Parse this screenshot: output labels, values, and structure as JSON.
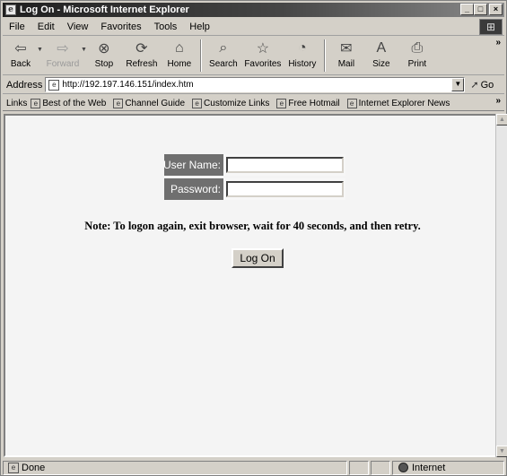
{
  "window": {
    "title": "Log On - Microsoft Internet Explorer"
  },
  "menu": [
    "File",
    "Edit",
    "View",
    "Favorites",
    "Tools",
    "Help"
  ],
  "toolbar": {
    "back": "Back",
    "forward": "Forward",
    "stop": "Stop",
    "refresh": "Refresh",
    "home": "Home",
    "search": "Search",
    "favorites": "Favorites",
    "history": "History",
    "mail": "Mail",
    "size": "Size",
    "print": "Print"
  },
  "address": {
    "label": "Address",
    "url": "http://192.197.146.151/index.htm",
    "go": "Go"
  },
  "links": {
    "label": "Links",
    "items": [
      "Best of the Web",
      "Channel Guide",
      "Customize Links",
      "Free Hotmail",
      "Internet Explorer News"
    ]
  },
  "form": {
    "username_label": "User Name:",
    "password_label": "Password:",
    "username_value": "",
    "password_value": "",
    "note": "Note: To logon again, exit browser, wait for 40 seconds, and then retry.",
    "submit_label": "Log On"
  },
  "status": {
    "text": "Done",
    "zone": "Internet"
  }
}
